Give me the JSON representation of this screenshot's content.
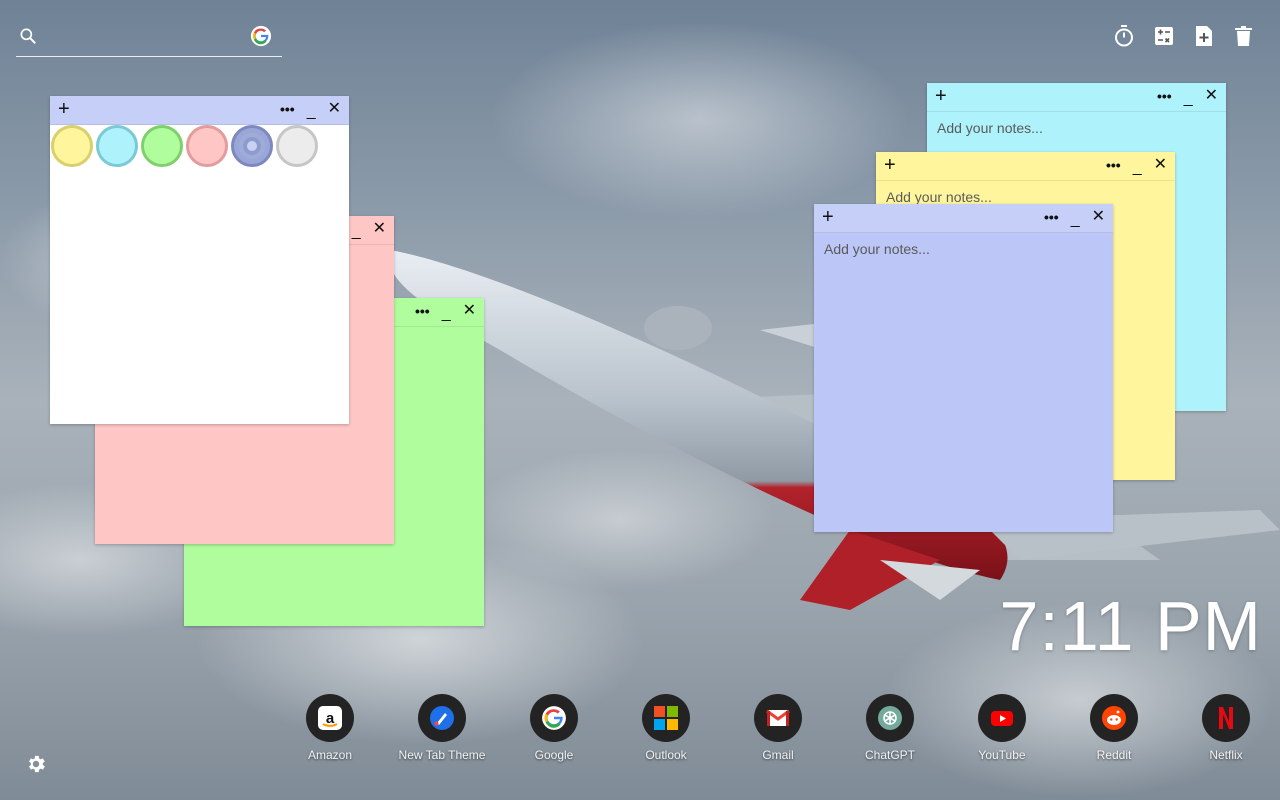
{
  "search": {
    "placeholder": "",
    "value": ""
  },
  "top_tools": [
    {
      "name": "timer-icon"
    },
    {
      "name": "calculator-icon"
    },
    {
      "name": "add-note-icon"
    },
    {
      "name": "trash-icon"
    }
  ],
  "notes": {
    "placeholder": "Add your notes...",
    "plus": "+",
    "dots": "•••",
    "minimize": "_",
    "close": "✕"
  },
  "colors": {
    "yellow": "#fff59d",
    "cyan": "#aef2fb",
    "green": "#b0fd9d",
    "pink": "#ffc6c6",
    "blue": "#bcc7f7",
    "white": "#ffffff",
    "yellow_bar": "#fff59d",
    "blue_bar": "#c6cff8"
  },
  "swatches": [
    {
      "name": "yellow",
      "fill": "#fff59d",
      "border": "#d9cf6b"
    },
    {
      "name": "cyan",
      "fill": "#aef2fb",
      "border": "#7cc9d6"
    },
    {
      "name": "green",
      "fill": "#b0fd9d",
      "border": "#7fd06c"
    },
    {
      "name": "pink",
      "fill": "#ffc6c6",
      "border": "#e49b9b"
    },
    {
      "name": "blue",
      "fill": "#9aa6d8",
      "border": "#7d89be",
      "selected": true
    },
    {
      "name": "gray",
      "fill": "#ececec",
      "border": "#c6c6c6"
    }
  ],
  "clock": {
    "time": "7:11 PM"
  },
  "dock": [
    {
      "label": "Amazon",
      "icon": "amazon-icon"
    },
    {
      "label": "New Tab Theme",
      "icon": "newtab-theme-icon"
    },
    {
      "label": "Google",
      "icon": "google-icon"
    },
    {
      "label": "Outlook",
      "icon": "outlook-icon"
    },
    {
      "label": "Gmail",
      "icon": "gmail-icon"
    },
    {
      "label": "ChatGPT",
      "icon": "chatgpt-icon"
    },
    {
      "label": "YouTube",
      "icon": "youtube-icon"
    },
    {
      "label": "Reddit",
      "icon": "reddit-icon"
    },
    {
      "label": "Netflix",
      "icon": "netflix-icon"
    }
  ]
}
